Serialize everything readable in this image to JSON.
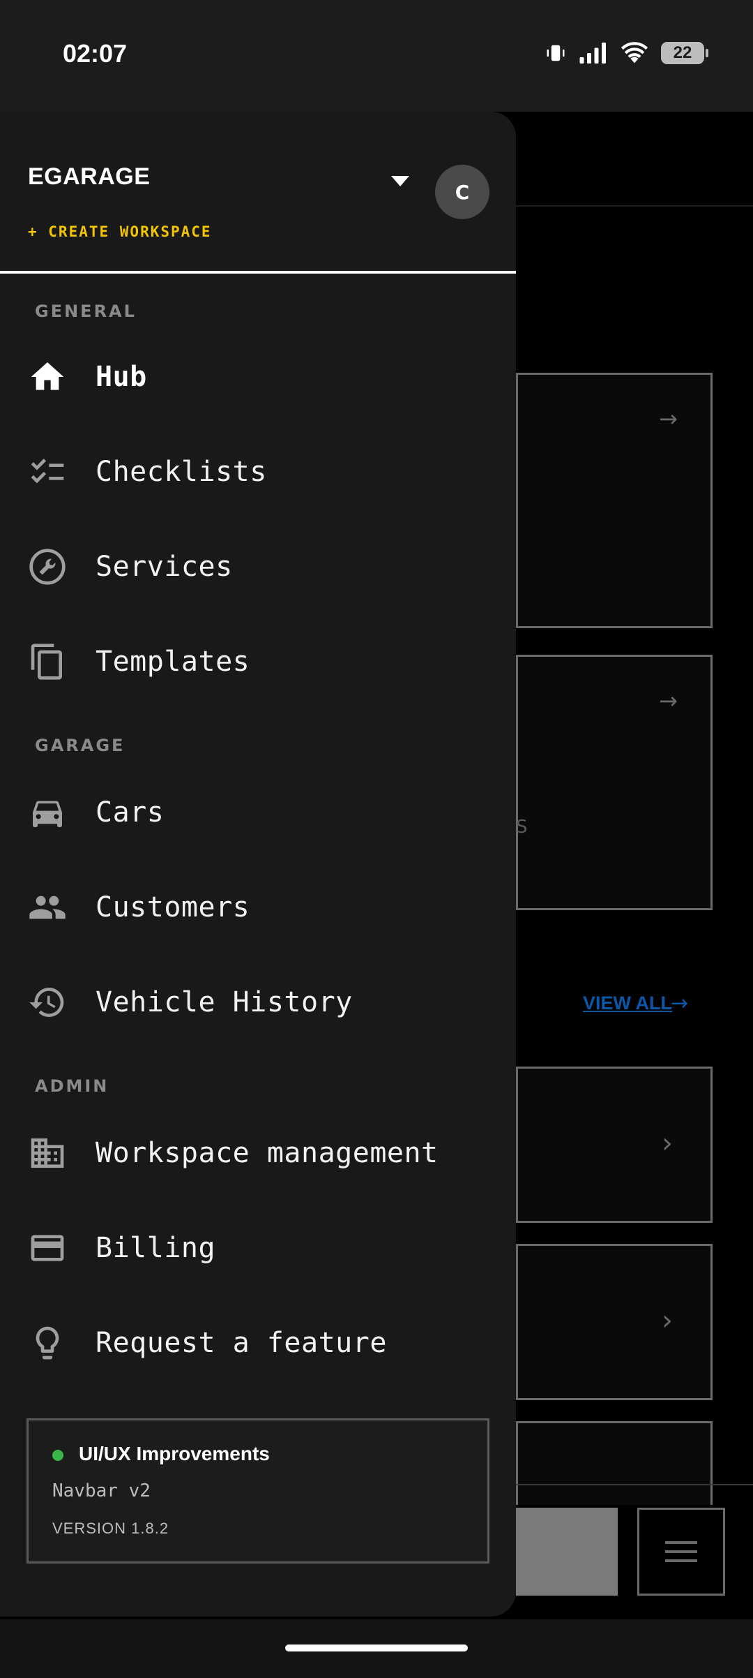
{
  "status_bar": {
    "time": "02:07",
    "battery": "22",
    "icons": [
      "vibrate-icon",
      "signal-icon",
      "wifi-icon",
      "battery-icon"
    ]
  },
  "drawer": {
    "workspace_name": "EGARAGE",
    "avatar_initial": "C",
    "create_workspace": "+ CREATE WORKSPACE",
    "sections": [
      {
        "label": "GENERAL",
        "items": [
          {
            "label": "Hub",
            "icon": "home-icon",
            "active": true
          },
          {
            "label": "Checklists",
            "icon": "checklist-icon"
          },
          {
            "label": "Services",
            "icon": "wrench-icon"
          },
          {
            "label": "Templates",
            "icon": "copy-icon"
          }
        ]
      },
      {
        "label": "GARAGE",
        "items": [
          {
            "label": "Cars",
            "icon": "car-icon"
          },
          {
            "label": "Customers",
            "icon": "people-icon"
          },
          {
            "label": "Vehicle History",
            "icon": "history-icon"
          }
        ]
      },
      {
        "label": "ADMIN",
        "items": [
          {
            "label": "Workspace management",
            "icon": "building-icon"
          },
          {
            "label": "Billing",
            "icon": "credit-card-icon"
          },
          {
            "label": "Request a feature",
            "icon": "lightbulb-icon"
          }
        ]
      }
    ],
    "release": {
      "title": "UI/UX Improvements",
      "subtitle": "Navbar v2",
      "version": "VERSION 1.8.2",
      "status_color": "#3ab54a"
    }
  },
  "background": {
    "view_all": "VIEW ALL",
    "partial_text": "S"
  },
  "colors": {
    "accent": "#f2c500",
    "link": "#0a57a8",
    "drawer_bg": "#191919"
  }
}
